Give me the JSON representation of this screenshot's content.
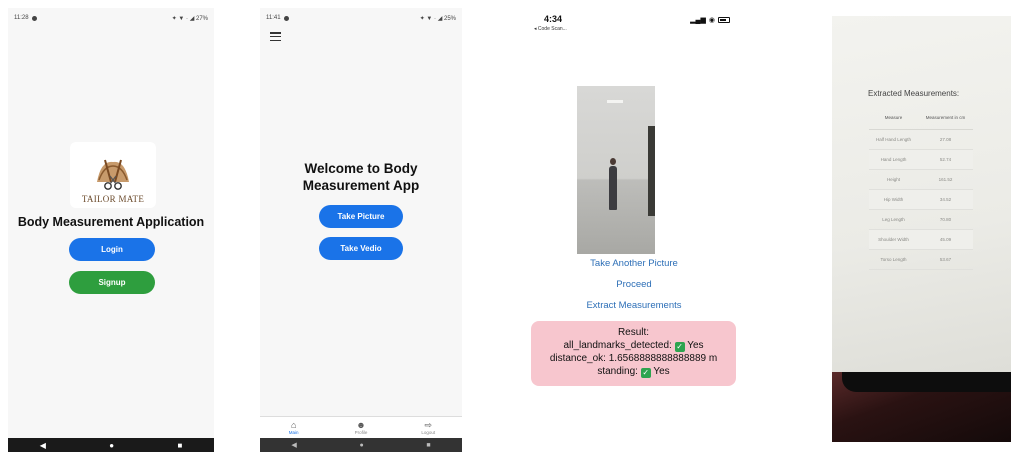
{
  "screen1": {
    "status_time": "11:28",
    "status_right": "✦ ▼ · ◢ 27%",
    "brand": "TAILOR MATE",
    "title": "Body Measurement Application",
    "login_label": "Login",
    "signup_label": "Signup",
    "colors": {
      "login": "#1a73e8",
      "signup": "#2e9e3e"
    }
  },
  "screen2": {
    "status_time": "11:41",
    "status_right": "✦ ▼ · ◢ 25%",
    "welcome_line1": "Welcome to Body",
    "welcome_line2": "Measurement App",
    "take_picture_label": "Take Picture",
    "take_video_label": "Take Vedio",
    "tabs": [
      {
        "label": "Main",
        "icon": "home-icon"
      },
      {
        "label": "Profile",
        "icon": "person-icon"
      },
      {
        "label": "Logout",
        "icon": "logout-icon"
      }
    ],
    "colors": {
      "button": "#1a73e8"
    }
  },
  "screen3": {
    "time": "4:34",
    "back_label": "◂ Code Scan...",
    "take_another_label": "Take Another Picture",
    "proceed_label": "Proceed",
    "extract_label": "Extract Measurements",
    "result": {
      "heading": "Result:",
      "landmarks_label": "all_landmarks_detected:",
      "landmarks_value": "Yes",
      "distance_text": "distance_ok: 1.6568888888888889 m",
      "standing_label": "standing:",
      "standing_value": "Yes"
    },
    "colors": {
      "link": "#2d6fb7",
      "result_bg": "#f7c6ce"
    }
  },
  "screen4": {
    "title": "Extracted Measurements:",
    "table": {
      "headers": [
        "Measure",
        "Measurement in cm"
      ],
      "rows": [
        [
          "Half Hand Length",
          "27.08"
        ],
        [
          "Hand Length",
          "52.74"
        ],
        [
          "Height",
          "161.52"
        ],
        [
          "Hip Width",
          "34.52"
        ],
        [
          "Leg Length",
          "70.80"
        ],
        [
          "Shoulder Width",
          "45.09"
        ],
        [
          "Torso Length",
          "53.67"
        ]
      ]
    }
  }
}
